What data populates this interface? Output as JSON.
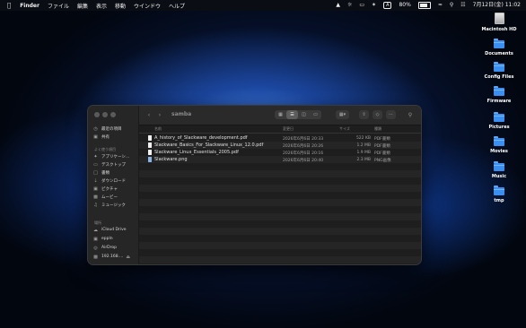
{
  "menubar": {
    "apple": "",
    "app": "Finder",
    "menus": [
      "ファイル",
      "編集",
      "表示",
      "移動",
      "ウインドウ",
      "ヘルプ"
    ],
    "input_mode": "A",
    "battery": "80%",
    "battery_level": 0.8,
    "datetime": "7月12日(金)  11:02"
  },
  "desktop": {
    "items": [
      {
        "label": "Macintosh HD",
        "icon": "drive-icon"
      },
      {
        "label": "Documents",
        "icon": "folder-icon"
      },
      {
        "label": "Config Files",
        "icon": "folder-icon"
      },
      {
        "label": "Firmware",
        "icon": "folder-icon"
      },
      {
        "label": "Pictures",
        "icon": "folder-icon"
      },
      {
        "label": "Movies",
        "icon": "folder-icon"
      },
      {
        "label": "Music",
        "icon": "folder-icon"
      },
      {
        "label": "tmp",
        "icon": "folder-icon"
      }
    ]
  },
  "window": {
    "title": "samba",
    "sidebar": {
      "items_top": [
        {
          "label": "最近の項目",
          "icon": "clock-icon"
        },
        {
          "label": "共有",
          "icon": "shared-icon"
        }
      ],
      "favorites_heading": "よく使う項目",
      "favorites": [
        {
          "label": "アプリケーシ...",
          "icon": "applications-icon"
        },
        {
          "label": "デスクトップ",
          "icon": "desktop-icon"
        },
        {
          "label": "書類",
          "icon": "document-icon"
        },
        {
          "label": "ダウンロード",
          "icon": "download-icon"
        },
        {
          "label": "ピクチャ",
          "icon": "picture-icon"
        },
        {
          "label": "ムービー",
          "icon": "movie-icon"
        },
        {
          "label": "ミュージック",
          "icon": "music-icon"
        }
      ],
      "locations_heading": "場所",
      "locations": [
        {
          "label": "iCloud Drive",
          "icon": "cloud-icon"
        },
        {
          "label": "eppln",
          "icon": "computer-icon"
        },
        {
          "label": "AirDrop",
          "icon": "airdrop-icon"
        },
        {
          "label": "192.168....",
          "icon": "network-icon"
        }
      ]
    },
    "columns": {
      "name": "名前",
      "date": "変更日",
      "size": "サイズ",
      "kind": "種類"
    },
    "files": [
      {
        "name": "A_history_of_Slackware_development.pdf",
        "date": "2026年6月6日 20:33",
        "size": "522 KB",
        "kind": "PDF書類",
        "type": "pdf"
      },
      {
        "name": "Slackware_Basics_For_Slackware_Linux_12.0.pdf",
        "date": "2026年6月6日 20:26",
        "size": "1.2 MB",
        "kind": "PDF書類",
        "type": "pdf"
      },
      {
        "name": "Slackware_Linux_Essentials_2005.pdf",
        "date": "2026年6月6日 20:16",
        "size": "1.9 MB",
        "kind": "PDF書類",
        "type": "pdf"
      },
      {
        "name": "Slackware.png",
        "date": "2026年6月6日 20:40",
        "size": "2.3 MB",
        "kind": "PNG画像",
        "type": "png"
      }
    ]
  }
}
